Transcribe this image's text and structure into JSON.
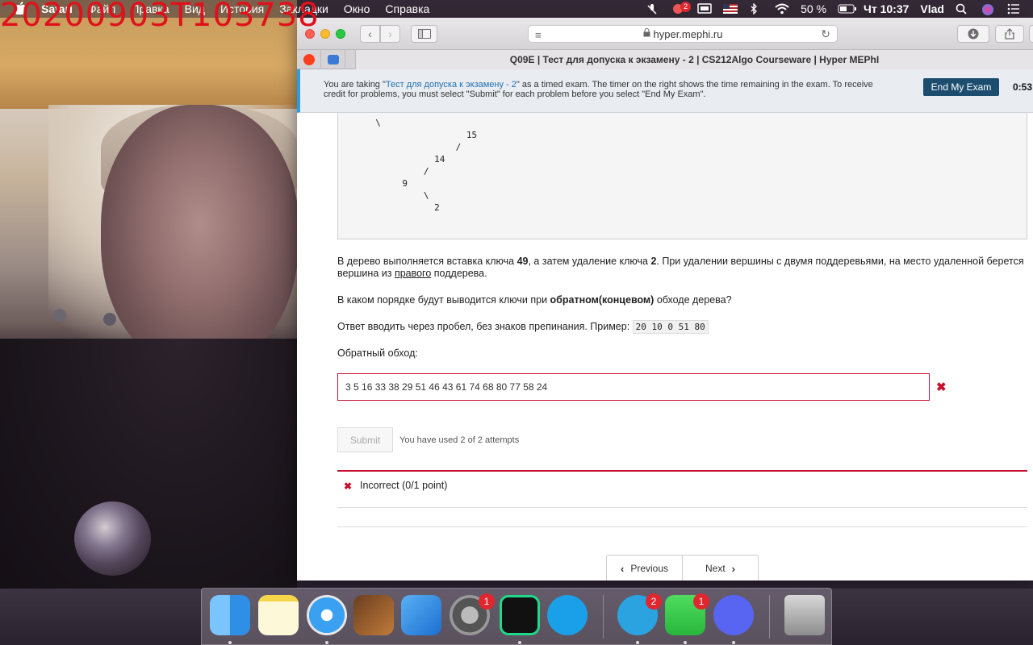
{
  "overlay": {
    "timestamp": "20200903T103738"
  },
  "menubar": {
    "apple_icon": "apple-icon",
    "app_name": "Safari",
    "items": [
      "Файл",
      "Правка",
      "Вид",
      "История",
      "Закладки",
      "Окно",
      "Справка"
    ],
    "battery": "50 %",
    "clock": "Чт 10:37",
    "user": "Vlad",
    "notification_badge": "2"
  },
  "browser": {
    "url": "hyper.mephi.ru",
    "tab_title": "Q09E | Тест для допуска к экзамену - 2 | CS212Algo Courseware | Hyper MEPhI"
  },
  "exam_banner": {
    "text_before": "You are taking \"",
    "exam_link": "Тест для допуска к экзамену - 2",
    "text_after": "\" as a timed exam. The timer on the right shows the time remaining in the exam. To receive credit for problems, you must select \"Submit\" for each problem before you select \"End My Exam\".",
    "end_button": "End My Exam",
    "timer": "0:53:"
  },
  "problem": {
    "tree_text": "  \\\n                   15\n                 /\n             14\n           /\n       9\n           \\\n             2",
    "p1_a": "В дерево выполняется вставка ключа ",
    "p1_key1": "49",
    "p1_b": ", а затем удаление ключа ",
    "p1_key2": "2",
    "p1_c": ". При удалении вершины с двумя поддеревьями, на место удаленной берется вершина из ",
    "p1_right": "правого",
    "p1_d": " поддерева.",
    "p2_a": "В каком порядке будут выводится ключи при ",
    "p2_bold": "обратном(концевом)",
    "p2_b": " обходе дерева?",
    "p3_a": "Ответ вводить через пробел, без знаков препинания. Пример: ",
    "p3_example": "20 10 0 51 80",
    "answer_label": "Обратный обход:",
    "answer_value": "3 5 16 33 38 29 51 46 43 61 74 68 80 77 58 24",
    "submit_label": "Submit",
    "attempts_text": "You have used 2 of 2 attempts",
    "result_text": "Incorrect (0/1 point)"
  },
  "pager": {
    "previous": "Previous",
    "next": "Next"
  },
  "dock": {
    "apps": [
      "Finder",
      "Notes",
      "Safari",
      "GarageBand",
      "Xcode",
      "System Preferences",
      "PyCharm",
      "Skype",
      "Telegram",
      "FaceTime",
      "Discord",
      "Trash"
    ],
    "badges": {
      "system_preferences": "1",
      "telegram": "2",
      "facetime": "1"
    }
  },
  "colors": {
    "accent_blue": "#1c4d6f",
    "error_red": "#c8102e",
    "link_blue": "#1f6fb3"
  }
}
